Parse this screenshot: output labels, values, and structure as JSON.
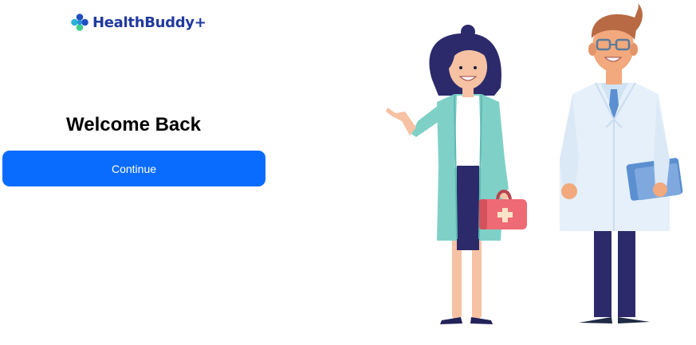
{
  "brand": {
    "name": "HealthBuddy+",
    "color": "#20399e",
    "logo_icon": "medical-cross-logo-icon"
  },
  "welcome": {
    "heading": "Welcome Back"
  },
  "actions": {
    "continue_label": "Continue",
    "continue_color": "#0a6cff"
  },
  "illustration": {
    "icon": "doctors-illustration",
    "figures": [
      "female-doctor-with-medical-bag",
      "male-doctor-with-clipboard"
    ]
  }
}
